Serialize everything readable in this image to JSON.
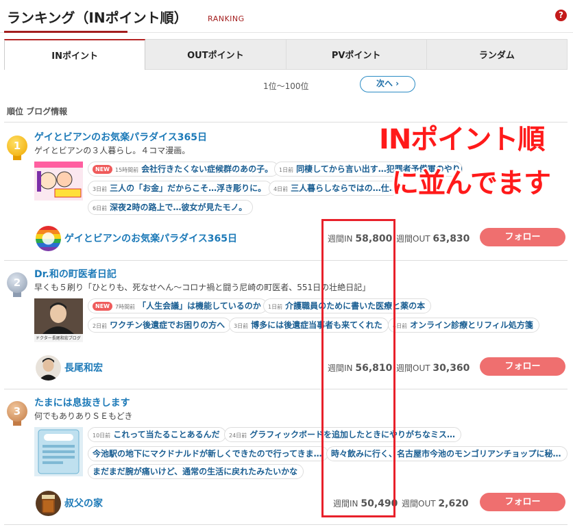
{
  "header": {
    "title": "ランキング（INポイント順）",
    "subtitle": "RANKING",
    "help": "?"
  },
  "tabs": [
    "INポイント",
    "OUTポイント",
    "PVポイント",
    "ランダム"
  ],
  "pager": {
    "range": "1位～100位",
    "next": "次へ ›"
  },
  "column_header": "順位 ブログ情報",
  "overlay": {
    "line1": "INポイント順",
    "line2": "に並んでます"
  },
  "stats_labels": {
    "in": "週間IN",
    "out": "週間OUT"
  },
  "follow_label": "フォロー",
  "entries": [
    {
      "rank": "1",
      "title": "ゲイとビアンのお気楽パラダイス365日",
      "desc": "ゲイとビアンの３人暮らし。４コマ漫画。",
      "articles": [
        {
          "new": "NEW",
          "ago": "15時間前",
          "text": "会社行きたくない症候群のあの子。"
        },
        {
          "ago": "1日前",
          "text": "同棲してから言い出す…犯罪者予備軍のやり口"
        },
        {
          "ago": "3日前",
          "text": "三人の「お金」だからこそ…浮き彫りに。"
        },
        {
          "ago": "4日前",
          "text": "三人暮らしならではの…仕…"
        },
        {
          "ago": "6日前",
          "text": "深夜2時の路上で…彼女が見たモノ。"
        }
      ],
      "author": "ゲイとビアンのお気楽パラダイス365日",
      "in": "58,800",
      "out": "63,830"
    },
    {
      "rank": "2",
      "title": "Dr.和の町医者日記",
      "desc": "早くも５刷り「ひとりも、死なせへん～コロナ禍と闘う尼崎の町医者、551日の壮絶日記」",
      "thumb_caption": "ドクター長尾和宏ブログ",
      "articles": [
        {
          "new": "NEW",
          "ago": "7時間前",
          "text": "「人生会議」は機能しているのか"
        },
        {
          "ago": "1日前",
          "text": "介護職員のために書いた医療と薬の本"
        },
        {
          "ago": "2日前",
          "text": "ワクチン後遺症でお困りの方へ"
        },
        {
          "ago": "3日前",
          "text": "博多には後遺症当事者も来てくれた"
        },
        {
          "ago": "4日前",
          "text": "オンライン診療とリフィル処方箋"
        }
      ],
      "author": "長尾和宏",
      "in": "56,810",
      "out": "30,360"
    },
    {
      "rank": "3",
      "title": "たまには息抜きします",
      "desc": "何でもありありＳＥもどき",
      "articles": [
        {
          "ago": "10日前",
          "text": "これって当たることあるんだ"
        },
        {
          "ago": "24日前",
          "text": "グラフィックボードを追加したときにやりがちなミス…"
        },
        {
          "text": "今池駅の地下にマクドナルドが新しくできたので行ってきま…"
        },
        {
          "text": "時々飲みに行く、名古屋市今池のモンゴリアンチョップに秘…"
        },
        {
          "text": "まだまだ腕が痛いけど、通常の生活に戻れたみたいかな"
        }
      ],
      "author": "叔父の家",
      "in": "50,490",
      "out": "2,620"
    }
  ]
}
